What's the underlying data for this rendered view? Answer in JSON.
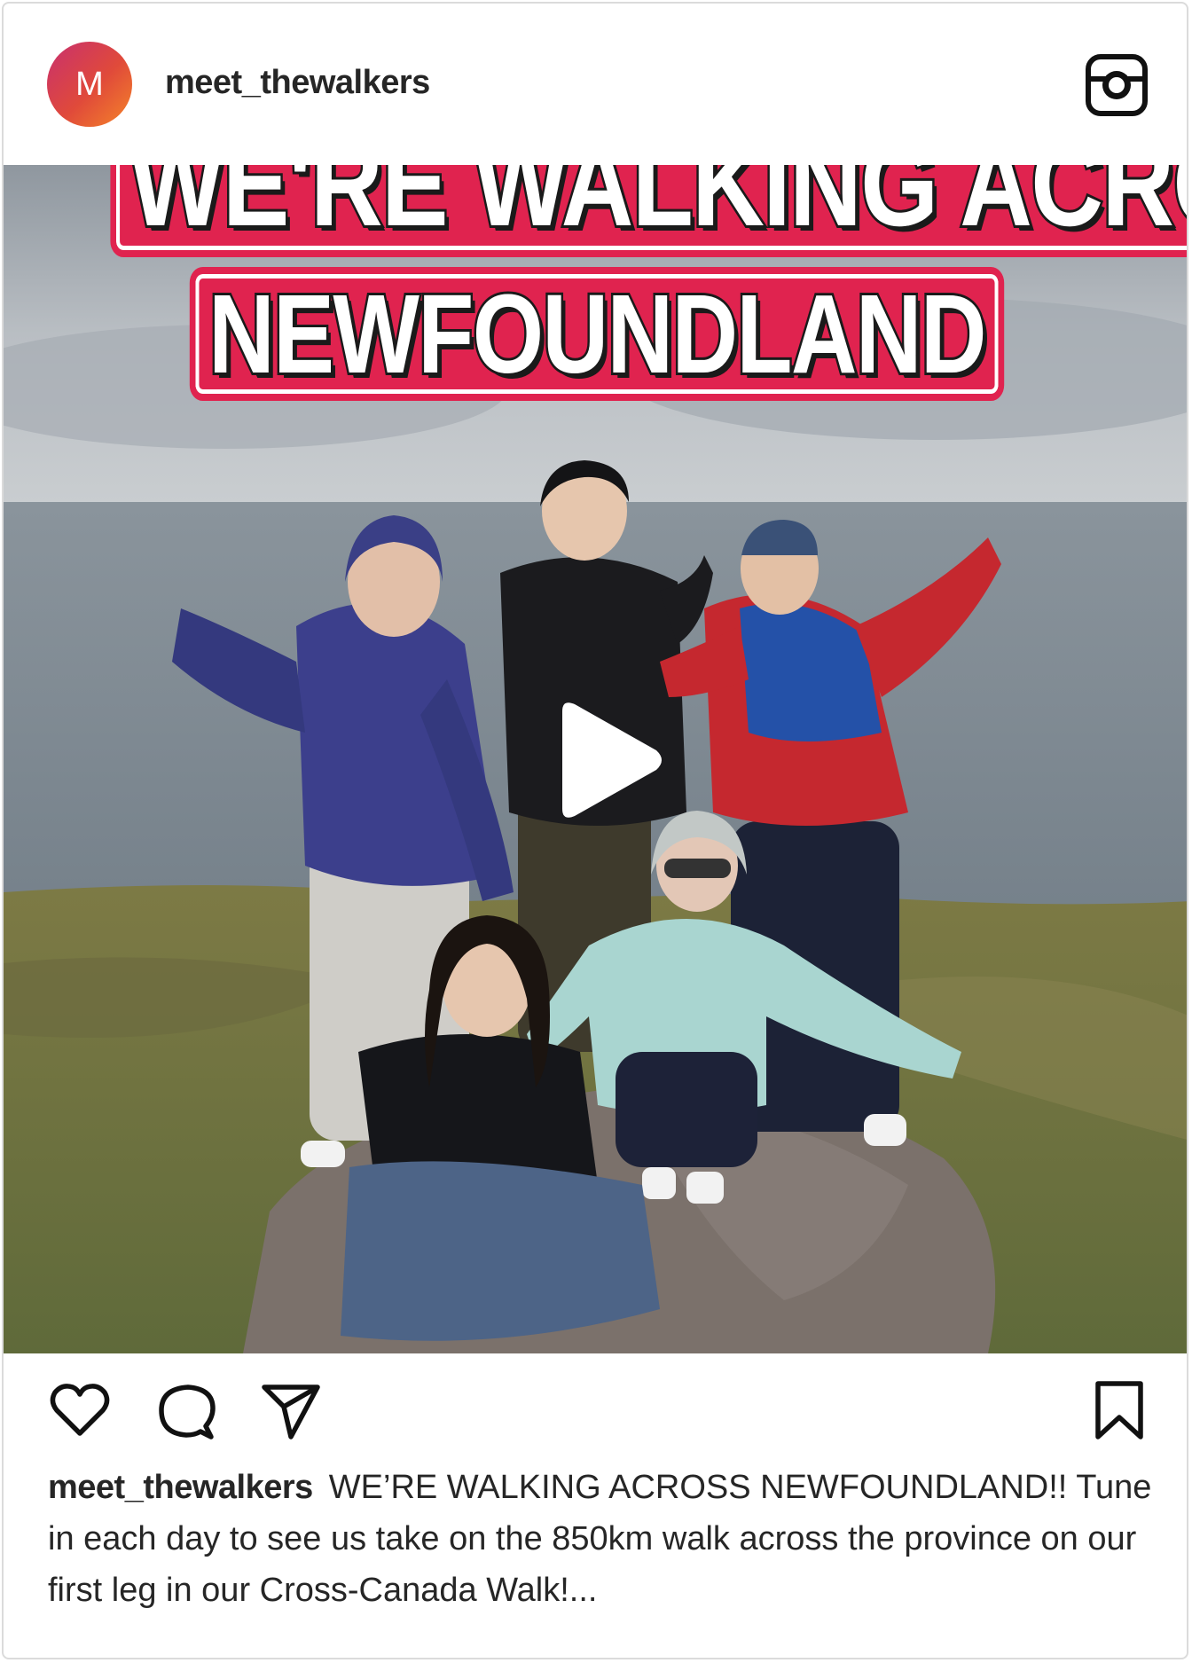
{
  "post": {
    "avatar_letter": "M",
    "username": "meet_thewalkers",
    "platform_icon": "instagram-icon",
    "media": {
      "overlay_line_1": "WE'RE WALKING ACROSS",
      "overlay_line_2": "NEWFOUNDLAND",
      "play_icon": "play-icon"
    },
    "actions": {
      "like_icon": "heart-icon",
      "comment_icon": "comment-icon",
      "share_icon": "send-icon",
      "save_icon": "bookmark-icon"
    },
    "caption": {
      "username": "meet_thewalkers",
      "text": "WE’RE WALKING ACROSS NEWFOUNDLAND!! Tune in each day to see us take on the 850km walk across the province on our first leg in our Cross-Canada Walk!..."
    }
  },
  "colors": {
    "border": "#dbdbdb",
    "text": "#262626",
    "overlay_red": "#e0234f",
    "avatar_gradient_start": "#c8306f",
    "avatar_gradient_end": "#f58529"
  }
}
